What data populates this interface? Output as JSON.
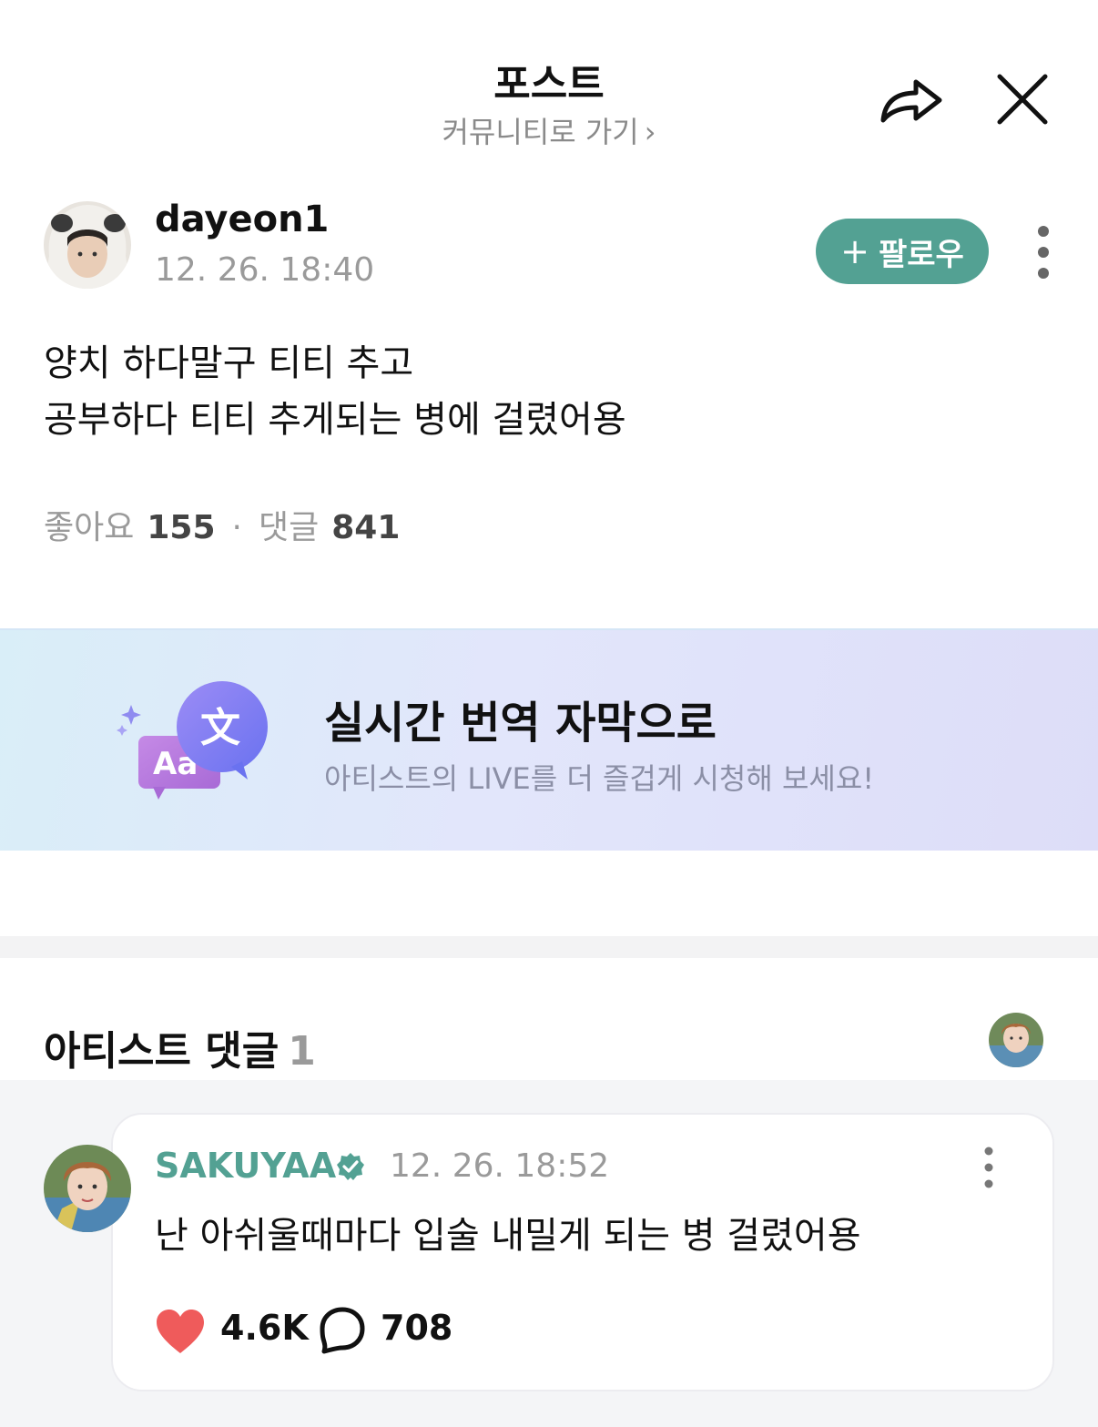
{
  "header": {
    "title": "포스트",
    "subtitle": "커뮤니티로 가기",
    "subtitle_chevron": "›"
  },
  "post": {
    "author": "dayeon1",
    "time": "12. 26. 18:40",
    "follow_label": "팔로우",
    "follow_plus": "+",
    "body_lines": [
      "양치 하다말구 티티 추고",
      "공부하다 티티 추게되는 병에 걸렸어용"
    ],
    "likes_label": "좋아요",
    "likes_count": "155",
    "separator": "·",
    "comments_label": "댓글",
    "comments_count": "841"
  },
  "banner": {
    "title": "실시간 번역 자막으로",
    "subtitle": "아티스트의 LIVE를 더 즐겁게 시청해 보세요!",
    "icon_glyph_front": "Aa",
    "icon_glyph_back": "文"
  },
  "artist_comments": {
    "header": "아티스트 댓글",
    "count": "1",
    "comment": {
      "name": "SAKUYAA",
      "time": "12. 26. 18:52",
      "text": "난 아쉬울때마다 입술 내밀게 되는 병 걸렸어용",
      "likes": "4.6K",
      "replies": "708"
    }
  },
  "colors": {
    "accent": "#53a193",
    "heart": "#ef5b5b",
    "muted": "#9a9a9a"
  },
  "icons": [
    "share-icon",
    "close-icon",
    "more-vertical-icon",
    "verified-badge-icon",
    "heart-icon",
    "reply-bubble-icon",
    "translate-icon"
  ]
}
